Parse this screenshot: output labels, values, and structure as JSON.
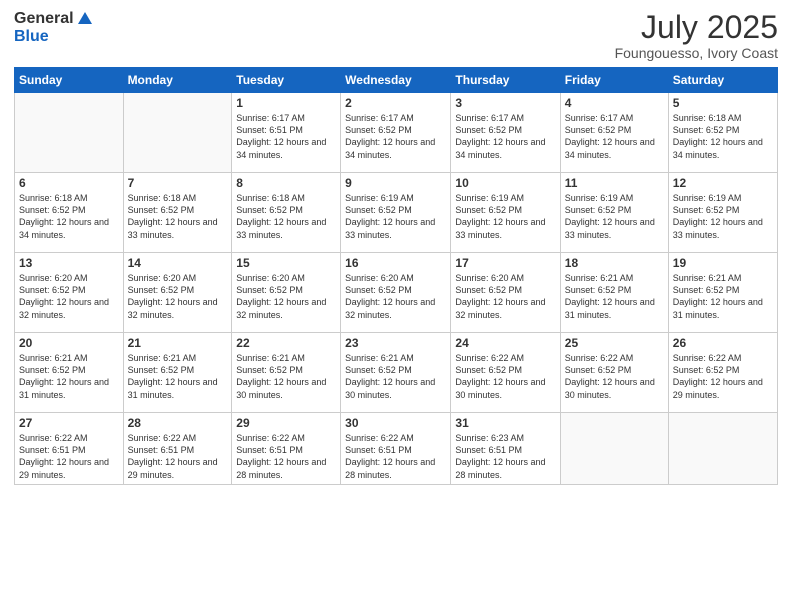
{
  "header": {
    "logo_general": "General",
    "logo_blue": "Blue",
    "month_title": "July 2025",
    "location": "Foungouesso, Ivory Coast"
  },
  "weekdays": [
    "Sunday",
    "Monday",
    "Tuesday",
    "Wednesday",
    "Thursday",
    "Friday",
    "Saturday"
  ],
  "weeks": [
    [
      {
        "day": "",
        "info": ""
      },
      {
        "day": "",
        "info": ""
      },
      {
        "day": "1",
        "info": "Sunrise: 6:17 AM\nSunset: 6:51 PM\nDaylight: 12 hours and 34 minutes."
      },
      {
        "day": "2",
        "info": "Sunrise: 6:17 AM\nSunset: 6:52 PM\nDaylight: 12 hours and 34 minutes."
      },
      {
        "day": "3",
        "info": "Sunrise: 6:17 AM\nSunset: 6:52 PM\nDaylight: 12 hours and 34 minutes."
      },
      {
        "day": "4",
        "info": "Sunrise: 6:17 AM\nSunset: 6:52 PM\nDaylight: 12 hours and 34 minutes."
      },
      {
        "day": "5",
        "info": "Sunrise: 6:18 AM\nSunset: 6:52 PM\nDaylight: 12 hours and 34 minutes."
      }
    ],
    [
      {
        "day": "6",
        "info": "Sunrise: 6:18 AM\nSunset: 6:52 PM\nDaylight: 12 hours and 34 minutes."
      },
      {
        "day": "7",
        "info": "Sunrise: 6:18 AM\nSunset: 6:52 PM\nDaylight: 12 hours and 33 minutes."
      },
      {
        "day": "8",
        "info": "Sunrise: 6:18 AM\nSunset: 6:52 PM\nDaylight: 12 hours and 33 minutes."
      },
      {
        "day": "9",
        "info": "Sunrise: 6:19 AM\nSunset: 6:52 PM\nDaylight: 12 hours and 33 minutes."
      },
      {
        "day": "10",
        "info": "Sunrise: 6:19 AM\nSunset: 6:52 PM\nDaylight: 12 hours and 33 minutes."
      },
      {
        "day": "11",
        "info": "Sunrise: 6:19 AM\nSunset: 6:52 PM\nDaylight: 12 hours and 33 minutes."
      },
      {
        "day": "12",
        "info": "Sunrise: 6:19 AM\nSunset: 6:52 PM\nDaylight: 12 hours and 33 minutes."
      }
    ],
    [
      {
        "day": "13",
        "info": "Sunrise: 6:20 AM\nSunset: 6:52 PM\nDaylight: 12 hours and 32 minutes."
      },
      {
        "day": "14",
        "info": "Sunrise: 6:20 AM\nSunset: 6:52 PM\nDaylight: 12 hours and 32 minutes."
      },
      {
        "day": "15",
        "info": "Sunrise: 6:20 AM\nSunset: 6:52 PM\nDaylight: 12 hours and 32 minutes."
      },
      {
        "day": "16",
        "info": "Sunrise: 6:20 AM\nSunset: 6:52 PM\nDaylight: 12 hours and 32 minutes."
      },
      {
        "day": "17",
        "info": "Sunrise: 6:20 AM\nSunset: 6:52 PM\nDaylight: 12 hours and 32 minutes."
      },
      {
        "day": "18",
        "info": "Sunrise: 6:21 AM\nSunset: 6:52 PM\nDaylight: 12 hours and 31 minutes."
      },
      {
        "day": "19",
        "info": "Sunrise: 6:21 AM\nSunset: 6:52 PM\nDaylight: 12 hours and 31 minutes."
      }
    ],
    [
      {
        "day": "20",
        "info": "Sunrise: 6:21 AM\nSunset: 6:52 PM\nDaylight: 12 hours and 31 minutes."
      },
      {
        "day": "21",
        "info": "Sunrise: 6:21 AM\nSunset: 6:52 PM\nDaylight: 12 hours and 31 minutes."
      },
      {
        "day": "22",
        "info": "Sunrise: 6:21 AM\nSunset: 6:52 PM\nDaylight: 12 hours and 30 minutes."
      },
      {
        "day": "23",
        "info": "Sunrise: 6:21 AM\nSunset: 6:52 PM\nDaylight: 12 hours and 30 minutes."
      },
      {
        "day": "24",
        "info": "Sunrise: 6:22 AM\nSunset: 6:52 PM\nDaylight: 12 hours and 30 minutes."
      },
      {
        "day": "25",
        "info": "Sunrise: 6:22 AM\nSunset: 6:52 PM\nDaylight: 12 hours and 30 minutes."
      },
      {
        "day": "26",
        "info": "Sunrise: 6:22 AM\nSunset: 6:52 PM\nDaylight: 12 hours and 29 minutes."
      }
    ],
    [
      {
        "day": "27",
        "info": "Sunrise: 6:22 AM\nSunset: 6:51 PM\nDaylight: 12 hours and 29 minutes."
      },
      {
        "day": "28",
        "info": "Sunrise: 6:22 AM\nSunset: 6:51 PM\nDaylight: 12 hours and 29 minutes."
      },
      {
        "day": "29",
        "info": "Sunrise: 6:22 AM\nSunset: 6:51 PM\nDaylight: 12 hours and 28 minutes."
      },
      {
        "day": "30",
        "info": "Sunrise: 6:22 AM\nSunset: 6:51 PM\nDaylight: 12 hours and 28 minutes."
      },
      {
        "day": "31",
        "info": "Sunrise: 6:23 AM\nSunset: 6:51 PM\nDaylight: 12 hours and 28 minutes."
      },
      {
        "day": "",
        "info": ""
      },
      {
        "day": "",
        "info": ""
      }
    ]
  ]
}
